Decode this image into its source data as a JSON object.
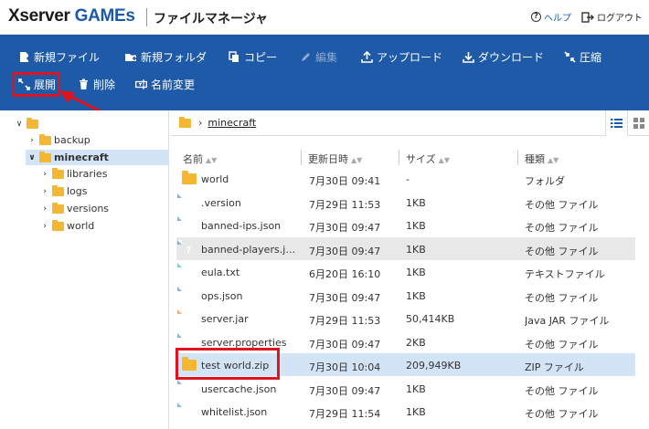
{
  "header": {
    "logo_main": "Xserver",
    "logo_accent": "GAMEs",
    "title": "ファイルマネージャ",
    "help_label": "ヘルプ",
    "logout_label": "ログアウト"
  },
  "toolbar": {
    "row1": [
      {
        "name": "new-file-button",
        "icon": "new-file-icon",
        "label": "新規ファイル",
        "enabled": true
      },
      {
        "name": "new-folder-button",
        "icon": "new-folder-icon",
        "label": "新規フォルダ",
        "enabled": true
      },
      {
        "name": "copy-button",
        "icon": "copy-icon",
        "label": "コピー",
        "enabled": true
      },
      {
        "name": "edit-button",
        "icon": "pencil-icon",
        "label": "編集",
        "enabled": false
      },
      {
        "name": "upload-button",
        "icon": "upload-icon",
        "label": "アップロード",
        "enabled": true
      },
      {
        "name": "download-button",
        "icon": "download-icon",
        "label": "ダウンロード",
        "enabled": true
      },
      {
        "name": "compress-button",
        "icon": "compress-icon",
        "label": "圧縮",
        "enabled": true
      }
    ],
    "row2": [
      {
        "name": "extract-button",
        "icon": "expand-icon",
        "label": "展開",
        "enabled": true
      },
      {
        "name": "delete-button",
        "icon": "trash-icon",
        "label": "削除",
        "enabled": true
      },
      {
        "name": "rename-button",
        "icon": "rename-icon",
        "label": "名前変更",
        "enabled": true
      }
    ]
  },
  "tree": [
    {
      "label": "",
      "depth": 0,
      "expanded": true,
      "selected": false,
      "icon": "folder-icon"
    },
    {
      "label": "backup",
      "depth": 1,
      "expanded": false,
      "selected": false,
      "icon": "folder-icon"
    },
    {
      "label": "minecraft",
      "depth": 1,
      "expanded": true,
      "selected": true,
      "icon": "folder-open-icon"
    },
    {
      "label": "libraries",
      "depth": 2,
      "expanded": false,
      "selected": false,
      "icon": "folder-icon"
    },
    {
      "label": "logs",
      "depth": 2,
      "expanded": false,
      "selected": false,
      "icon": "folder-icon"
    },
    {
      "label": "versions",
      "depth": 2,
      "expanded": false,
      "selected": false,
      "icon": "folder-icon"
    },
    {
      "label": "world",
      "depth": 2,
      "expanded": false,
      "selected": false,
      "icon": "folder-icon"
    }
  ],
  "breadcrumb": {
    "current": "minecraft"
  },
  "table": {
    "headers": [
      "名前",
      "更新日時",
      "サイズ",
      "種類"
    ],
    "rows": [
      {
        "name": "world",
        "date": "7月30日 09:41",
        "size": "-",
        "type": "フォルダ",
        "icon": "folder",
        "state": ""
      },
      {
        "name": ".version",
        "date": "7月29日 11:53",
        "size": "1KB",
        "type": "その他 ファイル",
        "icon": "unknown",
        "state": ""
      },
      {
        "name": "banned-ips.json",
        "date": "7月30日 09:47",
        "size": "1KB",
        "type": "その他 ファイル",
        "icon": "unknown",
        "state": ""
      },
      {
        "name": "banned-players.json",
        "date": "7月30日 09:47",
        "size": "1KB",
        "type": "その他 ファイル",
        "icon": "unknown",
        "state": "hover"
      },
      {
        "name": "eula.txt",
        "date": "6月20日 16:10",
        "size": "1KB",
        "type": "テキストファイル",
        "icon": "text",
        "state": ""
      },
      {
        "name": "ops.json",
        "date": "7月30日 09:47",
        "size": "1KB",
        "type": "その他 ファイル",
        "icon": "unknown",
        "state": ""
      },
      {
        "name": "server.jar",
        "date": "7月29日 11:53",
        "size": "50,414KB",
        "type": "Java JAR ファイル",
        "icon": "jar",
        "state": ""
      },
      {
        "name": "server.properties",
        "date": "7月30日 09:47",
        "size": "2KB",
        "type": "その他 ファイル",
        "icon": "unknown",
        "state": ""
      },
      {
        "name": "test world.zip",
        "date": "7月30日 10:04",
        "size": "209,949KB",
        "type": "ZIP ファイル",
        "icon": "folder",
        "state": "selected"
      },
      {
        "name": "usercache.json",
        "date": "7月30日 09:47",
        "size": "1KB",
        "type": "その他 ファイル",
        "icon": "unknown",
        "state": ""
      },
      {
        "name": "whitelist.json",
        "date": "7月29日 11:54",
        "size": "1KB",
        "type": "その他 ファイル",
        "icon": "unknown",
        "state": ""
      }
    ]
  },
  "colors": {
    "toolbar_bg": "#1e5aa8",
    "selection": "#d4e4f7",
    "highlight": "#e0141e",
    "folder": "#f5b731"
  }
}
